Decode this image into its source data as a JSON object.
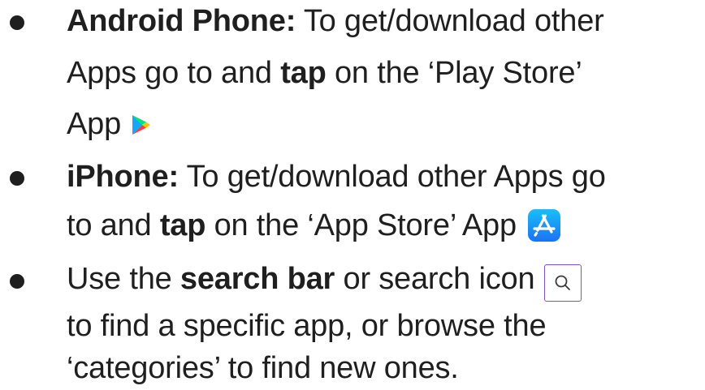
{
  "bullets": [
    {
      "lines": [
        {
          "bold": "Android Phone:",
          "text": " To get/download other"
        },
        {
          "pre": "Apps go to and ",
          "bold": "tap",
          "post": " on  the ‘Play Store’"
        },
        {
          "text": "App"
        }
      ],
      "icon": "play-store-icon"
    },
    {
      "lines": [
        {
          "bold": "iPhone:",
          "text": " To get/download other Apps go"
        },
        {
          "pre": "to and ",
          "bold": "tap",
          "post": " on the ‘App Store’ App"
        }
      ],
      "icon": "app-store-icon"
    },
    {
      "lines": [
        {
          "pre": "Use the ",
          "bold": "search bar",
          "post": " or search icon"
        },
        {
          "text": "to find a specific app, or browse the"
        },
        {
          "text": "‘categories’ to find new ones."
        }
      ],
      "icon": "search-icon"
    }
  ],
  "colors": {
    "text": "#1f1f1f",
    "search_border": "#7f4fc9",
    "app_store_blue": "#1c8ef9"
  }
}
